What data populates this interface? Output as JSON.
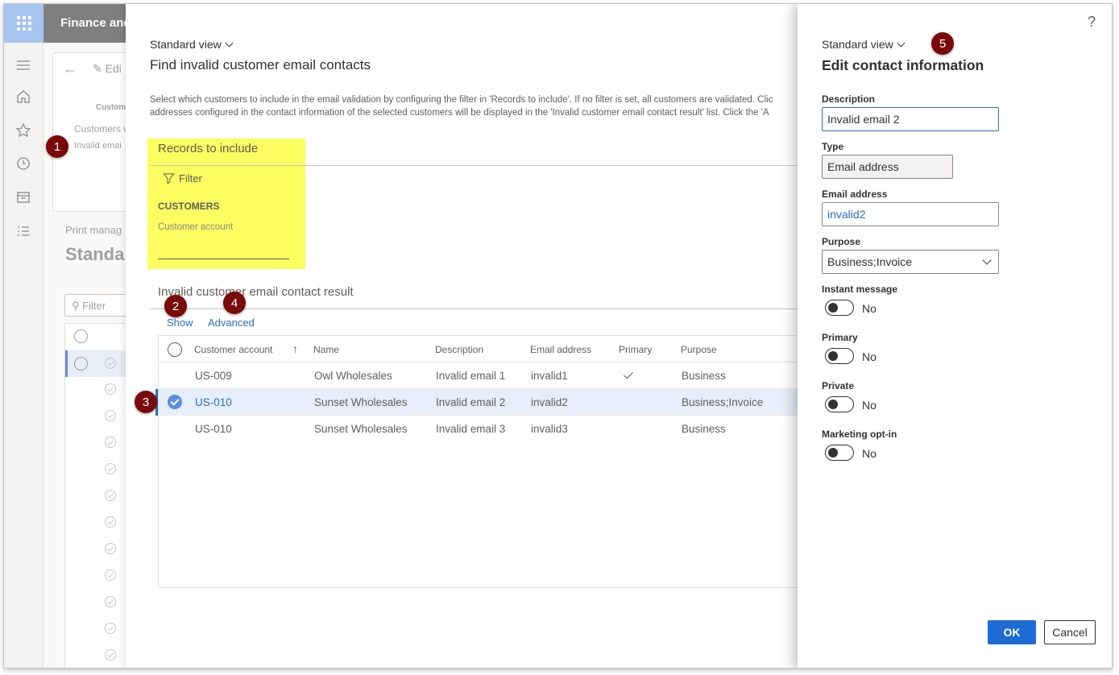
{
  "app": {
    "title": "Finance and"
  },
  "background": {
    "edit_label": "Edi",
    "customer_label": "Custom",
    "item1": "Customers w",
    "item2": "Invalid emai",
    "print_label": "Print manag",
    "view_title": "Standa",
    "filter_placeholder": "Filter"
  },
  "dialog": {
    "view": "Standard view",
    "title": "Find invalid customer email contacts",
    "instructions": [
      "Select which customers to include in the email validation by configuring the filter in 'Records to include'. If no filter is set, all customers are validated. Clic",
      "addresses configured in the contact information of the selected customers will be displayed in the 'Invalid customer email contact result' list. Click the 'A"
    ],
    "records": {
      "title": "Records to include",
      "filter_label": "Filter",
      "heading": "CUSTOMERS",
      "field_label": "Customer account"
    },
    "result": {
      "title": "Invalid customer email contact result",
      "show_label": "Show",
      "advanced_label": "Advanced",
      "columns": [
        "Customer account",
        "Name",
        "Description",
        "Email address",
        "Primary",
        "Purpose"
      ],
      "rows": [
        {
          "account": "US-009",
          "name": "Owl Wholesales",
          "description": "Invalid email 1",
          "email": "invalid1",
          "primary": true,
          "purpose": "Business",
          "selected": false
        },
        {
          "account": "US-010",
          "name": "Sunset Wholesales",
          "description": "Invalid email 2",
          "email": "invalid2",
          "primary": false,
          "purpose": "Business;Invoice",
          "selected": true
        },
        {
          "account": "US-010",
          "name": "Sunset Wholesales",
          "description": "Invalid email 3",
          "email": "invalid3",
          "primary": false,
          "purpose": "Business",
          "selected": false
        }
      ]
    }
  },
  "panel": {
    "help": "?",
    "view": "Standard view",
    "title": "Edit contact information",
    "fields": {
      "description_label": "Description",
      "description_value": "Invalid email 2",
      "type_label": "Type",
      "type_value": "Email address",
      "email_label": "Email address",
      "email_value": "invalid2",
      "purpose_label": "Purpose",
      "purpose_value": "Business;Invoice"
    },
    "toggles": [
      {
        "label": "Instant message",
        "value": "No"
      },
      {
        "label": "Primary",
        "value": "No"
      },
      {
        "label": "Private",
        "value": "No"
      },
      {
        "label": "Marketing opt-in",
        "value": "No"
      }
    ],
    "ok_label": "OK",
    "cancel_label": "Cancel"
  },
  "markers": [
    "1",
    "2",
    "3",
    "4",
    "5"
  ],
  "colors": {
    "accent": "#1f6bd6",
    "highlight": "#fbfd60",
    "marker": "#7a0a0a",
    "header": "#7f7f7f"
  }
}
